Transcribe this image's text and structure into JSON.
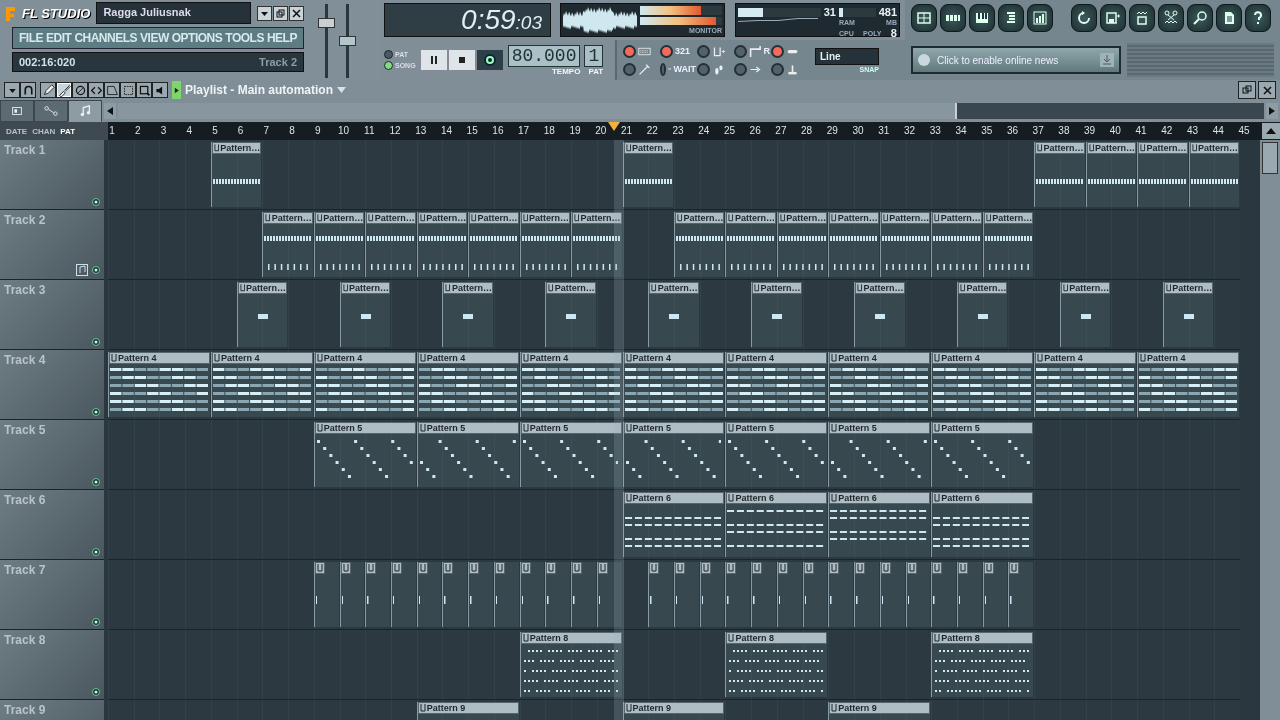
{
  "header": {
    "logo": "FL STUDIO",
    "song_title": "Ragga Juliusnak",
    "menu": [
      "FILE",
      "EDIT",
      "CHANNELS",
      "VIEW",
      "OPTIONS",
      "TOOLS",
      "HELP"
    ],
    "hint_time": "002:16:020",
    "hint_target": "Track 2",
    "sliders": [
      {
        "kind": "volume",
        "level": 0.78
      },
      {
        "kind": "pitch",
        "level": 0.5
      }
    ]
  },
  "time": {
    "main": "0:59",
    "sub": ":03"
  },
  "monitor": {
    "label": "MONITOR",
    "meters": [
      {
        "level": 0.74
      },
      {
        "level": 0.93
      }
    ]
  },
  "cpu": {
    "cpu_value": "31",
    "ram_value": "481",
    "ram_label": "RAM",
    "mb_label": "MB",
    "cpu_label": "CPU",
    "poly_label": "POLY",
    "poly_value": "8",
    "meters": [
      {
        "level": 0.3
      },
      {
        "level": 0.12
      }
    ]
  },
  "tools": [
    {
      "kind": "playlist"
    },
    {
      "kind": "sequencer"
    },
    {
      "kind": "piano"
    },
    {
      "kind": "browser"
    },
    {
      "kind": "mixer"
    },
    {
      "kind": "undo"
    },
    {
      "kind": "save"
    },
    {
      "kind": "export"
    },
    {
      "kind": "cut"
    },
    {
      "kind": "magnifier"
    },
    {
      "kind": "page"
    },
    {
      "kind": "help"
    }
  ],
  "transport": {
    "modes": [
      {
        "label": "PAT",
        "selected": false
      },
      {
        "label": "SONG",
        "selected": true
      }
    ],
    "buttons": [
      {
        "kind": "pause"
      },
      {
        "kind": "stop"
      },
      {
        "kind": "record"
      }
    ],
    "tempo": "80.000",
    "tempo_label": "TEMPO",
    "pattern": "1",
    "pattern_label": "PAT"
  },
  "options": {
    "toggles": [
      {
        "kind": "keyboard",
        "on": true
      },
      {
        "kind": "countdown",
        "caption": "321",
        "on": true
      },
      {
        "kind": "metronome",
        "on": false
      },
      {
        "kind": "loop-record",
        "caption": "R",
        "on": false
      },
      {
        "kind": "link",
        "on": true
      },
      {
        "kind": "wand",
        "on": false
      },
      {
        "kind": "wait",
        "caption": "WAIT",
        "on": false
      },
      {
        "kind": "step",
        "on": false
      },
      {
        "kind": "arrow",
        "on": false
      },
      {
        "kind": "joystick",
        "on": false
      }
    ],
    "snap_value": "Line",
    "snap_label": "SNAP"
  },
  "news": {
    "text": "Click to enable online news"
  },
  "playlist": {
    "title": "Playlist - Main automation",
    "tools": [
      {
        "kind": "menu",
        "selected": false
      },
      {
        "kind": "magnet",
        "selected": false
      },
      {
        "kind": "pencil",
        "selected": false
      },
      {
        "kind": "brush",
        "selected": true
      },
      {
        "kind": "mute",
        "selected": false
      },
      {
        "kind": "slip",
        "selected": false
      },
      {
        "kind": "slice",
        "selected": false
      },
      {
        "kind": "select",
        "selected": false
      },
      {
        "kind": "zoom",
        "selected": false
      },
      {
        "kind": "speaker",
        "selected": false
      }
    ],
    "view_tabs": [
      {
        "kind": "pattern",
        "selected": false
      },
      {
        "kind": "automation",
        "selected": false
      },
      {
        "kind": "note",
        "selected": true
      }
    ],
    "lane_modes": [
      {
        "label": "DATE",
        "selected": false
      },
      {
        "label": "CHAN",
        "selected": false
      },
      {
        "label": "PAT",
        "selected": true
      }
    ],
    "bars": [
      "1",
      "2",
      "3",
      "4",
      "5",
      "6",
      "7",
      "8",
      "9",
      "10",
      "11",
      "12",
      "13",
      "14",
      "15",
      "16",
      "17",
      "18",
      "19",
      "20",
      "21",
      "22",
      "23",
      "24",
      "25",
      "26",
      "27",
      "28",
      "29",
      "30",
      "31",
      "32",
      "33",
      "34",
      "35",
      "36",
      "37",
      "38",
      "39",
      "40",
      "41",
      "42",
      "43",
      "44",
      "45"
    ],
    "playhead": {
      "level": 0.447
    },
    "tracks": [
      {
        "name": "Track 1",
        "kind": "strip",
        "channel_icon": false,
        "clips": [
          {
            "label": "Pattern…"
          },
          {
            "label": "Pattern…"
          },
          {
            "label": "Pattern…"
          },
          {
            "label": "Pattern…"
          },
          {
            "label": "Pattern…"
          },
          {
            "label": "Pattern…"
          }
        ]
      },
      {
        "name": "Track 2",
        "kind": "strip-ticks",
        "channel_icon": true,
        "clips": [
          {
            "label": "Pattern…"
          },
          {
            "label": "Pattern…"
          },
          {
            "label": "Pattern…"
          },
          {
            "label": "Pattern…"
          },
          {
            "label": "Pattern…"
          },
          {
            "label": "Pattern…"
          },
          {
            "label": "Pattern…"
          },
          {
            "label": "Pattern…"
          },
          {
            "label": "Pattern…"
          },
          {
            "label": "Pattern…"
          },
          {
            "label": "Pattern…"
          },
          {
            "label": "Pattern…"
          },
          {
            "label": "Pattern…"
          },
          {
            "label": "Pattern…"
          }
        ]
      },
      {
        "name": "Track 3",
        "kind": "dot",
        "channel_icon": false,
        "clips": [
          {
            "label": "Pattern…"
          },
          {
            "label": "Pattern…"
          },
          {
            "label": "Pattern…"
          },
          {
            "label": "Pattern…"
          },
          {
            "label": "Pattern…"
          },
          {
            "label": "Pattern…"
          },
          {
            "label": "Pattern…"
          },
          {
            "label": "Pattern…"
          },
          {
            "label": "Pattern…"
          },
          {
            "label": "Pattern…"
          }
        ]
      },
      {
        "name": "Track 4",
        "kind": "stripes",
        "channel_icon": false,
        "clips": [
          {
            "label": "Pattern 4"
          },
          {
            "label": "Pattern 4"
          },
          {
            "label": "Pattern 4"
          },
          {
            "label": "Pattern 4"
          },
          {
            "label": "Pattern 4"
          },
          {
            "label": "Pattern 4"
          },
          {
            "label": "Pattern 4"
          },
          {
            "label": "Pattern 4"
          },
          {
            "label": "Pattern 4"
          },
          {
            "label": "Pattern 4"
          },
          {
            "label": "Pattern 4"
          }
        ]
      },
      {
        "name": "Track 5",
        "kind": "scatter",
        "channel_icon": false,
        "clips": [
          {
            "label": "Pattern 5"
          },
          {
            "label": "Pattern 5"
          },
          {
            "label": "Pattern 5"
          },
          {
            "label": "Pattern 5"
          },
          {
            "label": "Pattern 5"
          },
          {
            "label": "Pattern 5"
          },
          {
            "label": "Pattern 5"
          }
        ]
      },
      {
        "name": "Track 6",
        "kind": "dashes",
        "channel_icon": false,
        "clips": [
          {
            "label": "Pattern 6"
          },
          {
            "label": "Pattern 6"
          },
          {
            "label": "Pattern 6"
          },
          {
            "label": "Pattern 6"
          }
        ]
      },
      {
        "name": "Track 7",
        "kind": "tick",
        "channel_icon": false
      },
      {
        "name": "Track 8",
        "kind": "dots-grid",
        "channel_icon": false,
        "clips": [
          {
            "label": "Pattern 8"
          },
          {
            "label": "Pattern 8"
          },
          {
            "label": "Pattern 8"
          }
        ]
      },
      {
        "name": "Track 9",
        "kind": "scatter",
        "channel_icon": false,
        "clips": [
          {
            "label": "Pattern 9"
          },
          {
            "label": "Pattern 9"
          },
          {
            "label": "Pattern 9"
          }
        ]
      }
    ]
  }
}
